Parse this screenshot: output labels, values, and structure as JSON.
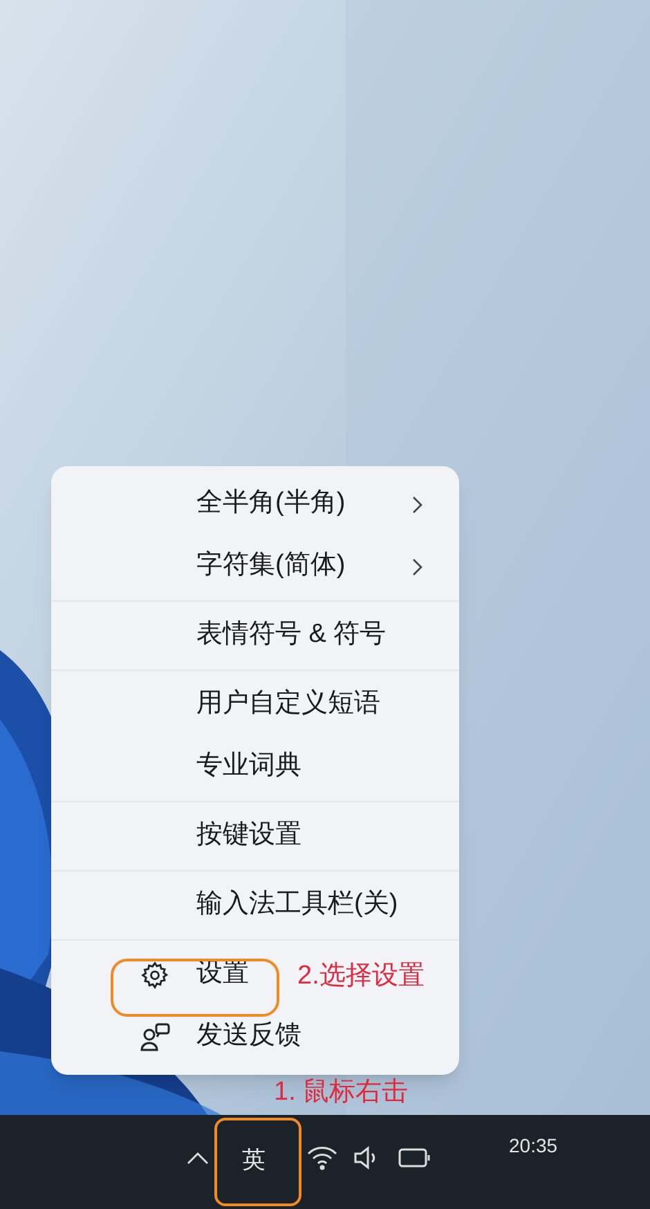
{
  "context_menu": {
    "items": [
      {
        "kind": "plain",
        "label": "全半角(半角)",
        "submenu": true,
        "divider_after": false
      },
      {
        "kind": "plain",
        "label": "字符集(简体)",
        "submenu": true,
        "divider_after": true
      },
      {
        "kind": "plain",
        "label": "表情符号 & 符号",
        "submenu": false,
        "divider_after": true
      },
      {
        "kind": "plain",
        "label": "用户自定义短语",
        "submenu": false,
        "divider_after": false
      },
      {
        "kind": "plain",
        "label": "专业词典",
        "submenu": false,
        "divider_after": true
      },
      {
        "kind": "plain",
        "label": "按键设置",
        "submenu": false,
        "divider_after": true
      },
      {
        "kind": "plain",
        "label": "输入法工具栏(关)",
        "submenu": false,
        "divider_after": true
      },
      {
        "kind": "settings",
        "label": "设置",
        "submenu": false,
        "divider_after": false
      },
      {
        "kind": "feedback",
        "label": "发送反馈",
        "submenu": false,
        "divider_after": false
      }
    ]
  },
  "annotations": [
    {
      "kind": "label",
      "text": "2.选择设置"
    },
    {
      "kind": "label",
      "text": "1. 鼠标右击"
    }
  ],
  "taskbar": {
    "input_indicator": "英",
    "clock": "20:35"
  }
}
